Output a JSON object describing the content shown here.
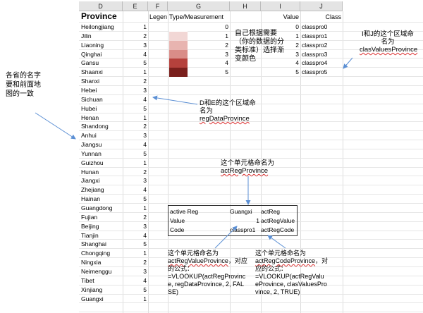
{
  "columns": [
    "D",
    "E",
    "F",
    "G",
    "H",
    "I",
    "J"
  ],
  "headers": {
    "province": "Province",
    "legend": "Legen",
    "type": "Type/Measurement",
    "value": "Value",
    "class": "Class"
  },
  "provinces": [
    {
      "name": "Heilongjiang",
      "val": "1"
    },
    {
      "name": "Jilin",
      "val": "2"
    },
    {
      "name": "Liaoning",
      "val": "3"
    },
    {
      "name": "Qinghai",
      "val": "4"
    },
    {
      "name": "Gansu",
      "val": "5"
    },
    {
      "name": "Shaanxi",
      "val": "1"
    },
    {
      "name": "Shanxi",
      "val": "2"
    },
    {
      "name": "Hebei",
      "val": "3"
    },
    {
      "name": "Sichuan",
      "val": "4"
    },
    {
      "name": "Hubei",
      "val": "5"
    },
    {
      "name": "Henan",
      "val": "1"
    },
    {
      "name": "Shandong",
      "val": "2"
    },
    {
      "name": "Anhui",
      "val": "3"
    },
    {
      "name": "Jiangsu",
      "val": "4"
    },
    {
      "name": "Yunnan",
      "val": "5"
    },
    {
      "name": "Guizhou",
      "val": "1"
    },
    {
      "name": "Hunan",
      "val": "2"
    },
    {
      "name": "Jiangxi",
      "val": "3"
    },
    {
      "name": "Zhejiang",
      "val": "4"
    },
    {
      "name": "Hainan",
      "val": "5"
    },
    {
      "name": "Guangdong",
      "val": "1"
    },
    {
      "name": "Fujian",
      "val": "2"
    },
    {
      "name": "Beijing",
      "val": "3"
    },
    {
      "name": "Tianjin",
      "val": "4"
    },
    {
      "name": "Shanghai",
      "val": "5"
    },
    {
      "name": "Chongqing",
      "val": "1"
    },
    {
      "name": "Ningxia",
      "val": "2"
    },
    {
      "name": "Neimenggu",
      "val": "3"
    },
    {
      "name": "Tibet",
      "val": "4"
    },
    {
      "name": "Xinjiang",
      "val": "5"
    },
    {
      "name": "Guangxi",
      "val": "1"
    }
  ],
  "legend_rows": [
    {
      "type": "0",
      "value": "0",
      "class": "classpro0",
      "color": "#ffffff"
    },
    {
      "type": "1",
      "value": "1",
      "class": "classpro1",
      "color": "#f2d7d5"
    },
    {
      "type": "2",
      "value": "2",
      "class": "classpro2",
      "color": "#e8b4b0"
    },
    {
      "type": "3",
      "value": "3",
      "class": "classpro3",
      "color": "#d98d88"
    },
    {
      "type": "4",
      "value": "4",
      "class": "classpro4",
      "color": "#b5413c"
    },
    {
      "type": "5",
      "value": "5",
      "class": "classpro5",
      "color": "#7a1f1c"
    }
  ],
  "active_box": {
    "rows": [
      {
        "label": "active Reg",
        "value": "Guangxi",
        "name": "actReg"
      },
      {
        "label": "Value",
        "value": "1",
        "name": "actRegValue"
      },
      {
        "label": "Code",
        "value": "classpro1",
        "name": "actRegCode"
      }
    ]
  },
  "notes": {
    "left": "各省的名字要和前面地图的一致",
    "color_pick": "自己根据需要（你的数据的分类标准）选择渐变颜色",
    "ij_name_1": "I和J的这个区域命名为",
    "ij_name_2": "clasValuesProvince",
    "de_name_1": "D和E的这个区域命名为",
    "de_name_2": "regDataProvince",
    "cell_name_1": "这个单元格命名为",
    "cell_name_2": "actRegProvince",
    "val_note_1": "这个单元格命名为",
    "val_note_2": "actRegValueProvince",
    "val_note_3": "，对应的公式：",
    "val_note_4": "=VLOOKUP(actRegProvince, regDataProvince, 2, FALSE)",
    "code_note_1": "这个单元格命名为",
    "code_note_2": "actRegCodeProvince",
    "code_note_3": "，对应的公式：",
    "code_note_4": "=VLOOKUP(actRegValueProvince, clasValuesProvince, 2, TRUE)"
  }
}
